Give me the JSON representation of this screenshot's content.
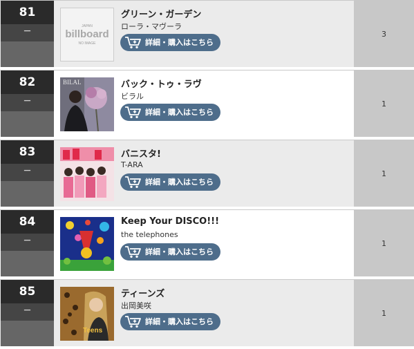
{
  "chart": {
    "entries": [
      {
        "rank": "81",
        "movement": "－",
        "title": "グリーン・ガーデン",
        "artist": "ローラ・マヴーラ",
        "weeks": "3",
        "jacket": "billboard-no-image",
        "jacket_text": {
          "japan": "JAPAN",
          "brand": "billboard",
          "note": "NO IMAGE"
        }
      },
      {
        "rank": "82",
        "movement": "－",
        "title": "バック・トゥ・ラヴ",
        "artist": "ビラル",
        "weeks": "1",
        "jacket": "bilal-cover",
        "jacket_text": {
          "name": "BILAL"
        }
      },
      {
        "rank": "83",
        "movement": "－",
        "title": "バニスタ!",
        "artist": "T-ARA",
        "weeks": "1",
        "jacket": "t-ara-cover"
      },
      {
        "rank": "84",
        "movement": "－",
        "title": "Keep Your DISCO!!!",
        "artist": "the telephones",
        "weeks": "1",
        "jacket": "telephones-cover"
      },
      {
        "rank": "85",
        "movement": "－",
        "title": "ティーンズ",
        "artist": "出岡美咲",
        "weeks": "1",
        "jacket": "teens-cover",
        "jacket_text": {
          "name": "Teens"
        }
      }
    ],
    "buy_label": "詳細・購入はこちら",
    "buy_icon": "cart-plus-icon",
    "colors": {
      "accent": "#4e6d8b",
      "rank_bg": "#2a2a2a",
      "weeks_bg": "#c8c8c8"
    }
  }
}
